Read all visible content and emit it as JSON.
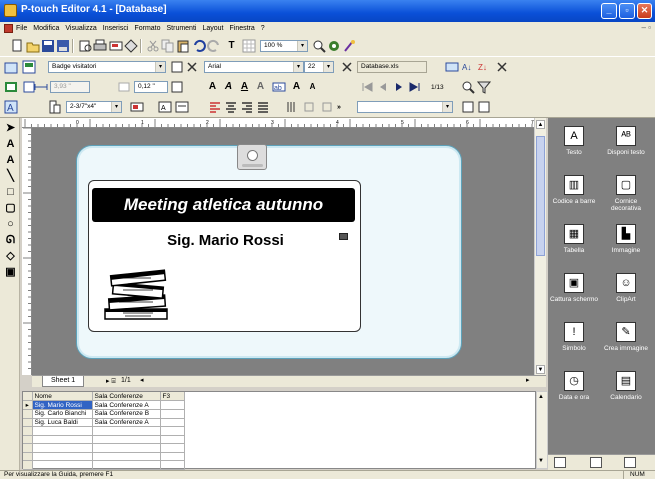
{
  "window": {
    "title": "P-touch Editor 4.1 - [Database]"
  },
  "menu": [
    "File",
    "Modifica",
    "Visualizza",
    "Inserisci",
    "Formato",
    "Strumenti",
    "Layout",
    "Finestra",
    "?"
  ],
  "toolbar": {
    "zoom": "100 %",
    "t_glyph": "T"
  },
  "props": {
    "layout_combo": "Badge visitatori",
    "length_value": "3,93 \"",
    "margin_value": "0,12 \"",
    "tape_combo": "2-3/7\"x4\"",
    "font_combo": "Arial",
    "font_size": "22",
    "db_file": "Database.xls",
    "record_pos": "1/13"
  },
  "badge": {
    "event_title": "Meeting atletica autunno",
    "person_name": "Sig. Mario Rossi"
  },
  "sheet": {
    "tab": "Sheet 1",
    "page": "1/1"
  },
  "ruler_numbers": [
    "0",
    "1",
    "2",
    "3",
    "4",
    "5",
    "6",
    "7"
  ],
  "grid": {
    "columns": [
      "Nome",
      "Sala Conferenze",
      "F3"
    ],
    "rows": [
      [
        "Sig. Mario Rossi",
        "Sala Conferenze A",
        ""
      ],
      [
        "Sig. Carlo Bianchi",
        "Sala Conferenze B",
        ""
      ],
      [
        "Sig. Luca Baldi",
        "Sala Conferenze A",
        ""
      ]
    ],
    "selected_row": 0
  },
  "side_palette": [
    {
      "label": "Testo",
      "icon": "text-icon"
    },
    {
      "label": "Disponi testo",
      "icon": "arrange-text-icon"
    },
    {
      "label": "Codice a barre",
      "icon": "barcode-icon"
    },
    {
      "label": "Cornice decorativa",
      "icon": "frame-icon"
    },
    {
      "label": "Tabella",
      "icon": "table-icon"
    },
    {
      "label": "Immagine",
      "icon": "image-icon"
    },
    {
      "label": "Cattura schermo",
      "icon": "screen-capture-icon"
    },
    {
      "label": "ClipArt",
      "icon": "clipart-icon"
    },
    {
      "label": "Simbolo",
      "icon": "symbol-icon"
    },
    {
      "label": "Crea immagine",
      "icon": "create-image-icon"
    },
    {
      "label": "Data e ora",
      "icon": "clock-icon"
    },
    {
      "label": "Calendario",
      "icon": "calendar-icon"
    }
  ],
  "status": {
    "message": "Per visualizzare la Guida, premere F1",
    "num": "NUM"
  },
  "colors": {
    "titlebar": "#0a50d8",
    "badge_border": "#5da2ba",
    "selection": "#3163c4"
  }
}
